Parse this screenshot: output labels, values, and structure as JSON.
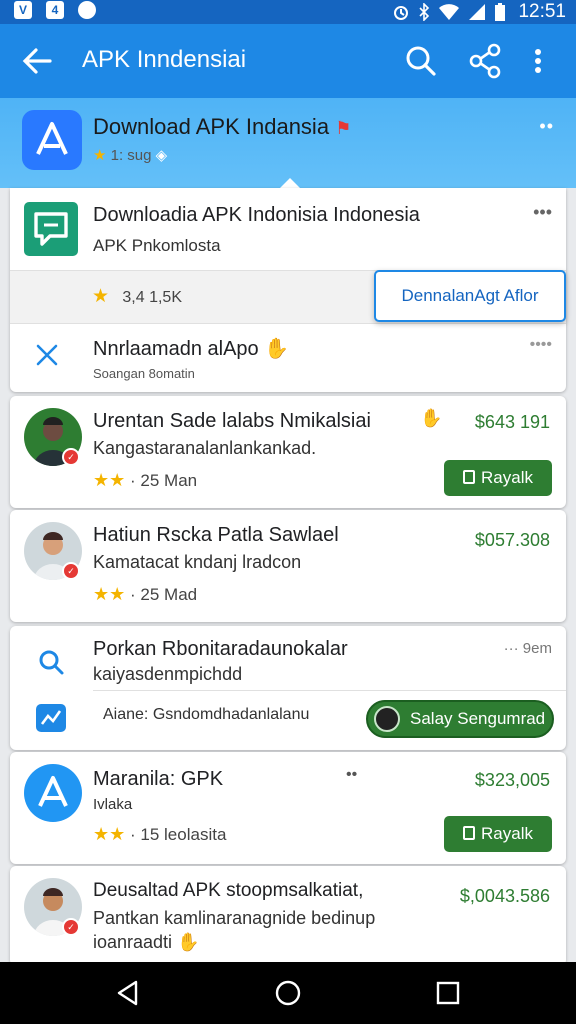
{
  "status_bar": {
    "left_icons": [
      "vodafone-icon",
      "notification-icon",
      "circle-icon"
    ],
    "left_glyphs": [
      "V",
      "4",
      "●"
    ],
    "time": "12:51"
  },
  "app_bar": {
    "title": "APK Inndensiai",
    "actions": [
      "search-icon",
      "share-icon",
      "more-vert-icon"
    ]
  },
  "banner": {
    "title": "Download APK Indansia",
    "sub": "1: sug",
    "more": "••"
  },
  "featured": {
    "title": "Downloadia APK Indonisia Indonesia",
    "sub": "APK Pnkomlosta",
    "more": "•••",
    "rating_text": "3,4 1,5K",
    "cta": "DennalanAgt Aflor",
    "item2_title": "Nnrlaamadn alApo",
    "item2_sub": "Soangan 8omatin",
    "item2_more": "••••"
  },
  "list": [
    {
      "title": "Urentan Sade lalabs Nmikalsiai",
      "sub": "Kangastaranalanlankankad.",
      "stars": "★★",
      "meta": "· 25 Man",
      "price": "$643 191",
      "button": "Rayalk"
    },
    {
      "title": "Hatiun Rscka Patla Sawlael",
      "sub": "Kamatacat kndanj lradcon",
      "stars": "★★",
      "meta": "· 25 Mad",
      "price": "$057.308"
    },
    {
      "title": "Porkan Rbonitaradaunokalar",
      "sub": "kaiyasdenmpichdd",
      "line3": "Aiane: Gsndomdhadanlalanu",
      "more": "··· 9em",
      "pill": "Salay Sengumrad"
    },
    {
      "title": "Maranila: GPK",
      "sub": "Ivlaka",
      "stars": "★★",
      "meta": "· 15 leolasita",
      "price": "$323,005",
      "button": "Rayalk",
      "more": "••"
    },
    {
      "title": "Deusaltad APK stoopmsalkatiat,",
      "sub": "Pantkan kamlinaranagnide bedinup",
      "line3": "ioanraadti",
      "price": "$,0043.586"
    }
  ],
  "colors": {
    "status_bar": "#1565c0",
    "app_bar": "#1e88e5",
    "price_green": "#2e7d32",
    "star": "#f4b400"
  }
}
